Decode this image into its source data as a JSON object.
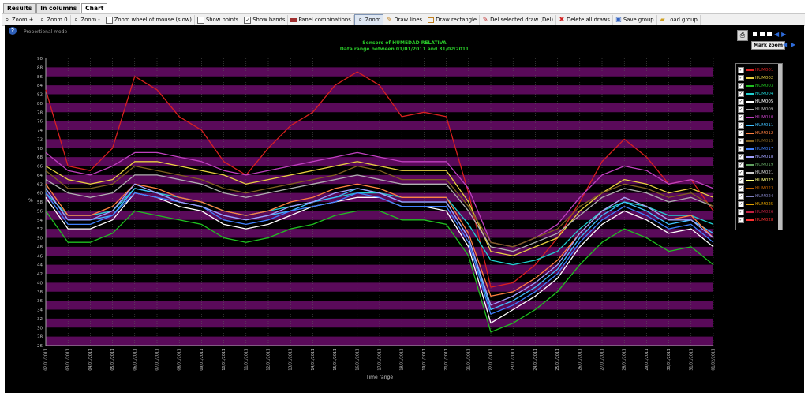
{
  "tabs": [
    "Results",
    "In columns",
    "Chart"
  ],
  "toolbar": {
    "zoom_in": "Zoom +",
    "zoom_0": "Zoom 0",
    "zoom_out": "Zoom -",
    "zoom_wheel": "Zoom wheel of mouse (slow)",
    "show_points": "Show points",
    "show_bands": "Show bands",
    "panel_combinations": "Panel combinations",
    "zoom": "Zoom",
    "draw_lines": "Draw lines",
    "draw_rectangle": "Draw rectangle",
    "del_selected": "Del selected draw (Del)",
    "delete_all": "Delete all draws",
    "save_group": "Save group",
    "load_group": "Load group"
  },
  "panel": {
    "mode_label": "Proportional mode",
    "title": "Sensors of HUMEDAD RELATIVA",
    "subtitle": "Data range between 01/01/2011 and 31/02/2011",
    "mark_zoom": "Mark zoom"
  },
  "legend": {
    "items": [
      {
        "name": "HUM001",
        "color": "#e02020"
      },
      {
        "name": "HUM002",
        "color": "#e8d040"
      },
      {
        "name": "HUM003",
        "color": "#20c020"
      },
      {
        "name": "HUM004",
        "color": "#20d0d0"
      },
      {
        "name": "HUM005",
        "color": "#ffffff"
      },
      {
        "name": "HUM009",
        "color": "#b0b0b0"
      },
      {
        "name": "HUM010",
        "color": "#c040c0"
      },
      {
        "name": "HUM011",
        "color": "#40c0ff"
      },
      {
        "name": "HUM012",
        "color": "#ff8040"
      },
      {
        "name": "HUM015",
        "color": "#806020"
      },
      {
        "name": "HUM017",
        "color": "#4080ff"
      },
      {
        "name": "HUM018",
        "color": "#a0a0ff"
      },
      {
        "name": "HUM019",
        "color": "#60a060"
      },
      {
        "name": "HUM021",
        "color": "#d0d0d0"
      },
      {
        "name": "HUM022",
        "color": "#ffff80"
      },
      {
        "name": "HUM023",
        "color": "#c06000"
      },
      {
        "name": "HUM024",
        "color": "#8080c0"
      },
      {
        "name": "HUM025",
        "color": "#e0a000"
      },
      {
        "name": "HUM026",
        "color": "#c02040"
      },
      {
        "name": "HUM028",
        "color": "#ff3030"
      }
    ]
  },
  "chart_data": {
    "type": "line",
    "title": "Sensors of HUMEDAD RELATIVA",
    "subtitle": "Data range between 01/01/2011 and 31/02/2011",
    "xlabel": "Time range",
    "ylabel": "%",
    "ylim": [
      26,
      90
    ],
    "yticks": [
      26,
      28,
      30,
      32,
      34,
      36,
      38,
      40,
      42,
      44,
      46,
      48,
      50,
      52,
      54,
      56,
      58,
      60,
      62,
      64,
      66,
      68,
      70,
      72,
      74,
      76,
      78,
      80,
      82,
      84,
      86,
      88,
      90
    ],
    "x": [
      "02/01/2011",
      "03/01/2011",
      "04/01/2011",
      "05/01/2011",
      "06/01/2011",
      "07/01/2011",
      "08/01/2011",
      "09/01/2011",
      "10/01/2011",
      "11/01/2011",
      "12/01/2011",
      "13/01/2011",
      "14/01/2011",
      "15/01/2011",
      "16/01/2011",
      "17/01/2011",
      "18/01/2011",
      "19/01/2011",
      "20/01/2011",
      "21/01/2011",
      "22/01/2011",
      "23/01/2011",
      "24/01/2011",
      "25/01/2011",
      "26/01/2011",
      "27/01/2011",
      "28/01/2011",
      "29/01/2011",
      "30/01/2011",
      "31/01/2011",
      "01/02/2011"
    ],
    "series": [
      {
        "name": "HUM001",
        "color": "#d82020",
        "values": [
          83,
          66,
          65,
          70,
          86,
          83,
          77,
          74,
          67,
          64,
          70,
          75,
          78,
          84,
          87,
          84,
          77,
          78,
          77,
          60,
          39,
          40,
          44,
          50,
          58,
          67,
          72,
          68,
          62,
          63,
          56
        ]
      },
      {
        "name": "HUM002",
        "color": "#e8d040",
        "values": [
          66,
          63,
          62,
          63,
          67,
          67,
          66,
          65,
          64,
          62,
          63,
          64,
          65,
          66,
          67,
          66,
          65,
          65,
          65,
          58,
          47,
          46,
          48,
          50,
          56,
          60,
          63,
          62,
          60,
          61,
          59
        ]
      },
      {
        "name": "HUM003",
        "color": "#20c020",
        "values": [
          56,
          49,
          49,
          51,
          56,
          55,
          54,
          53,
          50,
          49,
          50,
          52,
          53,
          55,
          56,
          56,
          54,
          54,
          53,
          46,
          29,
          31,
          34,
          38,
          44,
          49,
          52,
          50,
          47,
          48,
          44
        ]
      },
      {
        "name": "HUM004",
        "color": "#20d0d0",
        "values": [
          60,
          55,
          55,
          56,
          61,
          60,
          59,
          58,
          56,
          55,
          56,
          57,
          58,
          59,
          60,
          60,
          59,
          59,
          59,
          53,
          45,
          44,
          45,
          47,
          52,
          56,
          58,
          57,
          55,
          55,
          53
        ]
      },
      {
        "name": "HUM005",
        "color": "#ffffff",
        "values": [
          59,
          52,
          52,
          54,
          60,
          59,
          57,
          56,
          53,
          52,
          53,
          55,
          57,
          58,
          59,
          59,
          57,
          57,
          56,
          48,
          31,
          34,
          37,
          41,
          48,
          53,
          56,
          54,
          51,
          52,
          48
        ]
      },
      {
        "name": "HUM009",
        "color": "#b0b0b0",
        "values": [
          63,
          60,
          59,
          60,
          64,
          64,
          63,
          62,
          60,
          59,
          60,
          61,
          62,
          63,
          64,
          63,
          62,
          62,
          62,
          56,
          48,
          47,
          49,
          51,
          55,
          59,
          61,
          60,
          58,
          59,
          57
        ]
      },
      {
        "name": "HUM010",
        "color": "#c040c0",
        "values": [
          69,
          65,
          64,
          66,
          69,
          69,
          68,
          67,
          65,
          64,
          65,
          66,
          67,
          68,
          69,
          68,
          67,
          67,
          67,
          61,
          49,
          48,
          50,
          53,
          59,
          64,
          66,
          65,
          62,
          63,
          61
        ]
      },
      {
        "name": "HUM011",
        "color": "#40c0ff",
        "values": [
          61,
          54,
          54,
          55,
          61,
          60,
          58,
          57,
          55,
          54,
          55,
          56,
          58,
          59,
          61,
          60,
          58,
          58,
          58,
          50,
          34,
          36,
          39,
          43,
          50,
          55,
          58,
          56,
          53,
          54,
          51
        ]
      },
      {
        "name": "HUM012",
        "color": "#ff8040",
        "values": [
          62,
          55,
          55,
          57,
          62,
          61,
          59,
          58,
          56,
          55,
          56,
          58,
          59,
          61,
          62,
          61,
          59,
          59,
          59,
          51,
          37,
          38,
          41,
          45,
          51,
          56,
          59,
          57,
          54,
          55,
          50
        ]
      },
      {
        "name": "HUM015",
        "color": "#806020",
        "values": [
          65,
          61,
          61,
          62,
          66,
          65,
          64,
          63,
          61,
          60,
          61,
          62,
          63,
          64,
          66,
          65,
          63,
          63,
          63,
          57,
          49,
          48,
          50,
          52,
          57,
          60,
          62,
          61,
          59,
          60,
          57
        ]
      },
      {
        "name": "HUM017",
        "color": "#4080ff",
        "values": [
          60,
          53,
          53,
          55,
          60,
          59,
          58,
          57,
          54,
          53,
          54,
          56,
          57,
          58,
          60,
          59,
          57,
          57,
          57,
          49,
          33,
          35,
          38,
          42,
          49,
          54,
          57,
          55,
          52,
          53,
          49
        ]
      },
      {
        "name": "HUM018",
        "color": "#a0a0ff",
        "values": [
          61,
          54,
          54,
          56,
          62,
          60,
          58,
          57,
          55,
          54,
          55,
          57,
          58,
          60,
          61,
          60,
          58,
          58,
          58,
          50,
          35,
          37,
          40,
          44,
          51,
          56,
          59,
          57,
          54,
          54,
          50
        ]
      }
    ]
  }
}
